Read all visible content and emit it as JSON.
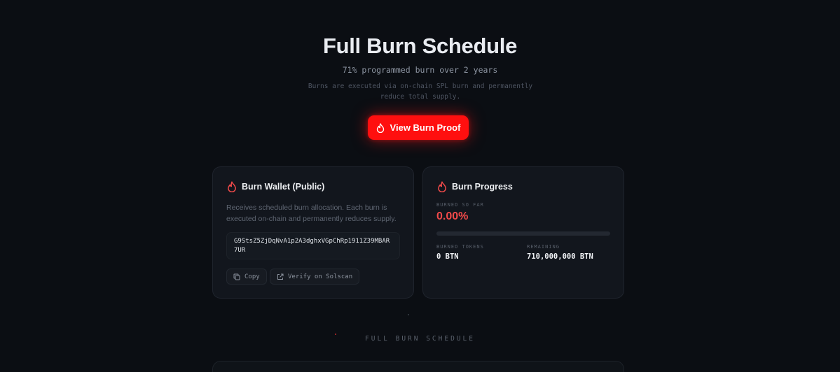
{
  "hero": {
    "title": "Full Burn Schedule",
    "subtitle": "71% programmed burn over 2 years",
    "description": "Burns are executed via on-chain SPL burn and permanently reduce total supply.",
    "proof_button": {
      "label": "View Burn Proof",
      "icon": "flame-icon"
    }
  },
  "wallet_card": {
    "title": "Burn Wallet (Public)",
    "icon": "flame-icon",
    "description": "Receives scheduled burn allocation. Each burn is executed on-chain and permanently reduces supply.",
    "address": "G9StsZ5ZjDqNvA1p2A3dghxVGpChRp1911Z39MBAR7UR",
    "copy_label": "Copy",
    "verify_label": "Verify on Solscan"
  },
  "progress_card": {
    "title": "Burn Progress",
    "icon": "flame-icon",
    "burned_so_far_label": "BURNED SO FAR",
    "burned_percent": "0.00%",
    "progress_fraction": 0,
    "burned_tokens_label": "BURNED TOKENS",
    "burned_tokens_value": "0 BTN",
    "remaining_label": "REMAINING",
    "remaining_value": "710,000,000 BTN"
  },
  "schedule": {
    "section_label": "FULL BURN SCHEDULE"
  },
  "colors": {
    "background": "#0b0e13",
    "accent": "#ff0f0f",
    "percent_text": "#f24a4a",
    "card_bg": "#12161d"
  }
}
